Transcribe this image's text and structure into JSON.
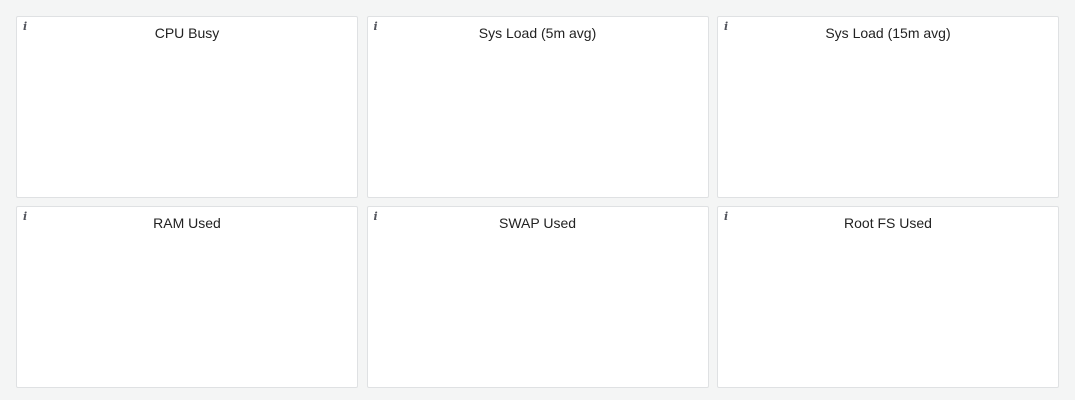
{
  "panels": [
    {
      "title": "CPU Busy",
      "info_icon": "i"
    },
    {
      "title": "Sys Load (5m avg)",
      "info_icon": "i"
    },
    {
      "title": "Sys Load (15m avg)",
      "info_icon": "i"
    },
    {
      "title": "RAM Used",
      "info_icon": "i"
    },
    {
      "title": "SWAP Used",
      "info_icon": "i"
    },
    {
      "title": "Root FS Used",
      "info_icon": "i"
    }
  ],
  "colors": {
    "background": "#f4f5f5",
    "panel_background": "#ffffff",
    "panel_border": "#dfe1e3",
    "title_text": "#222222",
    "icon_color": "#52545c"
  }
}
